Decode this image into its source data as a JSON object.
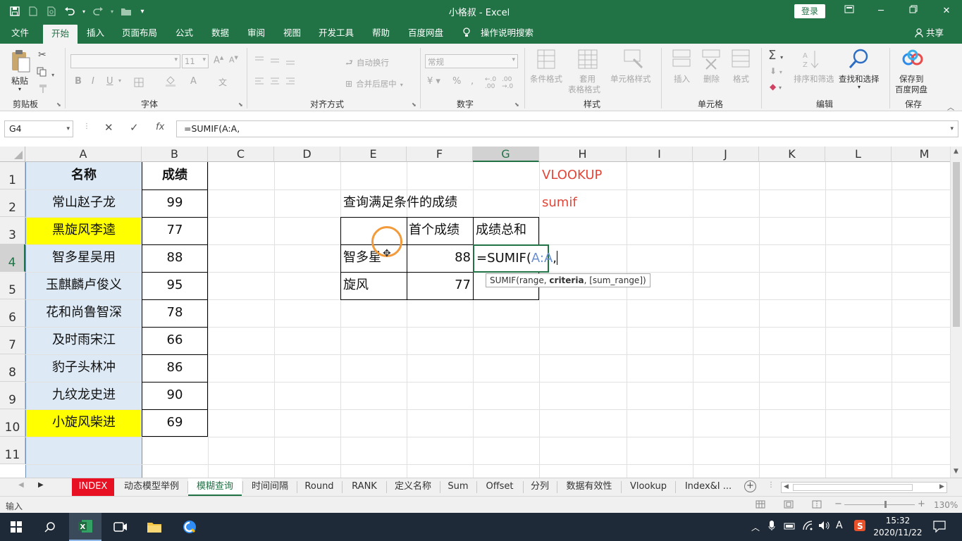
{
  "window": {
    "title": "小格叔  -  Excel",
    "login_label": "登录",
    "share_label": "共享"
  },
  "menu": {
    "tabs": [
      "文件",
      "开始",
      "插入",
      "页面布局",
      "公式",
      "数据",
      "审阅",
      "视图",
      "开发工具",
      "帮助",
      "百度网盘"
    ],
    "search_label": "操作说明搜索"
  },
  "ribbon": {
    "clipboard": {
      "paste": "粘贴",
      "label": "剪贴板"
    },
    "font": {
      "size": "11",
      "bold": "B",
      "italic": "I",
      "underline": "U",
      "label": "字体"
    },
    "alignment": {
      "wrap": "自动换行",
      "merge": "合并后居中",
      "label": "对齐方式"
    },
    "number": {
      "format": "常规",
      "label": "数字"
    },
    "styles": {
      "conditional": "条件格式",
      "table_1": "套用",
      "table_2": "表格格式",
      "cell": "单元格样式",
      "label": "样式"
    },
    "cells": {
      "insert": "插入",
      "delete": "删除",
      "format": "格式",
      "label": "单元格"
    },
    "editing": {
      "sort": "排序和筛选",
      "find": "查找和选择",
      "label": "编辑"
    },
    "save": {
      "line1": "保存到",
      "line2": "百度网盘",
      "label": "保存"
    }
  },
  "formula_bar": {
    "name_box": "G4",
    "formula": "=SUMIF(A:A,",
    "fx": "fx"
  },
  "grid": {
    "columns": [
      "A",
      "B",
      "C",
      "D",
      "E",
      "F",
      "G",
      "H",
      "I",
      "J",
      "K",
      "L",
      "M"
    ],
    "rows": [
      "1",
      "2",
      "3",
      "4",
      "5",
      "6",
      "7",
      "8",
      "9",
      "10",
      "11"
    ],
    "names_header": "名称",
    "scores_header": "成绩",
    "names": [
      "常山赵子龙",
      "黑旋风李逵",
      "智多星吴用",
      "玉麒麟卢俊义",
      "花和尚鲁智深",
      "及时雨宋江",
      "豹子头林冲",
      "九纹龙史进",
      "小旋风柴进"
    ],
    "scores": [
      "99",
      "77",
      "88",
      "95",
      "78",
      "66",
      "86",
      "90",
      "69"
    ],
    "highlight_color": "#ffff00",
    "query_title": "查询满足条件的成绩",
    "first_score_header": "首个成绩",
    "total_header": "成绩总和",
    "query_key_1": "智多星",
    "query_val_1": "88",
    "query_key_2": "旋风",
    "query_val_2": "77",
    "editing_cell_prefix": "=SUMIF(",
    "editing_cell_ref": "A:A",
    "editing_cell_suffix": ",",
    "note_1": "VLOOKUP",
    "note_2": "sumif",
    "note_color": "#e0473a",
    "tooltip_prefix": "SUMIF(range, ",
    "tooltip_bold": "criteria",
    "tooltip_suffix": ", [sum_range])"
  },
  "sheet_tabs": [
    "INDEX",
    "动态模型举例",
    "模糊查询",
    "时间间隔",
    "Round",
    "RANK",
    "定义名称",
    "Sum",
    "Offset",
    "分列",
    "数据有效性",
    "Vlookup",
    "Index&I ..."
  ],
  "active_sheet": "模糊查询",
  "status": {
    "mode": "输入",
    "zoom": "130%"
  },
  "taskbar": {
    "time": "15:32",
    "date": "2020/11/22",
    "ime": "A"
  }
}
